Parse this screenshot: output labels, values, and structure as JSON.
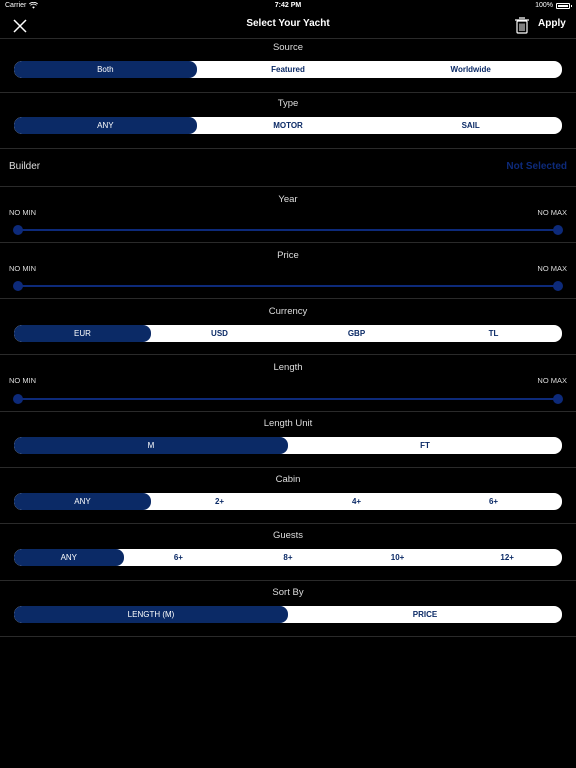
{
  "status": {
    "carrier": "Carrier",
    "time": "7:42 PM",
    "battery": "100%"
  },
  "nav": {
    "title": "Select Your Yacht",
    "apply": "Apply"
  },
  "source": {
    "title": "Source",
    "options": [
      "Both",
      "Featured",
      "Worldwide"
    ],
    "selected": "Both"
  },
  "type": {
    "title": "Type",
    "options": [
      "ANY",
      "MOTOR",
      "SAIL"
    ],
    "selected": "ANY"
  },
  "builder": {
    "label": "Builder",
    "value": "Not Selected"
  },
  "year": {
    "title": "Year",
    "min": "NO MIN",
    "max": "NO MAX"
  },
  "price": {
    "title": "Price",
    "min": "NO MIN",
    "max": "NO MAX"
  },
  "currency": {
    "title": "Currency",
    "options": [
      "EUR",
      "USD",
      "GBP",
      "TL"
    ],
    "selected": "EUR"
  },
  "length": {
    "title": "Length",
    "min": "NO MIN",
    "max": "NO MAX"
  },
  "length_unit": {
    "title": "Length Unit",
    "options": [
      "M",
      "FT"
    ],
    "selected": "M"
  },
  "cabin": {
    "title": "Cabin",
    "options": [
      "ANY",
      "2+",
      "4+",
      "6+"
    ],
    "selected": "ANY"
  },
  "guests": {
    "title": "Guests",
    "options": [
      "ANY",
      "6+",
      "8+",
      "10+",
      "12+"
    ],
    "selected": "ANY"
  },
  "sort_by": {
    "title": "Sort By",
    "options": [
      "LENGTH (M)",
      "PRICE"
    ],
    "selected": "LENGTH (M)"
  },
  "colors": {
    "accent": "#0b2a66",
    "background": "#000000",
    "segment_bg": "#ffffff"
  }
}
